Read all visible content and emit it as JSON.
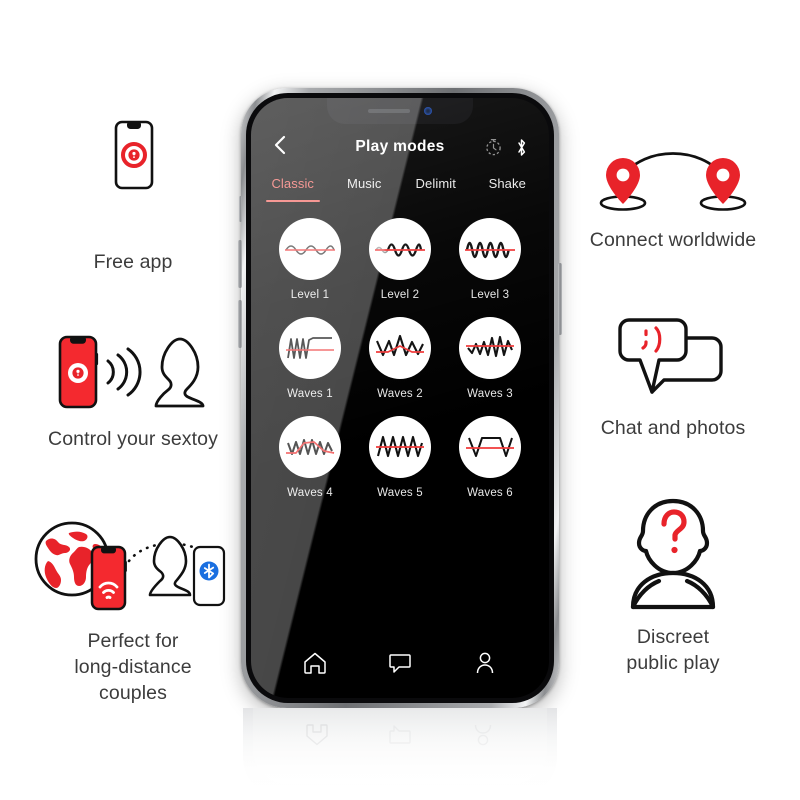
{
  "page": {
    "background_color": "#ffffff",
    "text_color": "#3c3c3c",
    "accent_red": "#e8232a",
    "app_accent": "#f2645f"
  },
  "features_left": [
    {
      "id": "free-app",
      "icon": "phone-with-lock-app-icon",
      "caption": "Free app"
    },
    {
      "id": "control-sextoy",
      "icon": "phone-signal-sextoy-icon",
      "caption": "Control your sextoy"
    },
    {
      "id": "long-distance",
      "icon": "globe-phone-sextoy-bluetooth-icon",
      "caption": "Perfect for\nlong-distance\ncouples"
    }
  ],
  "features_right": [
    {
      "id": "connect-worldwide",
      "icon": "two-map-pins-arc-icon",
      "caption": "Connect worldwide"
    },
    {
      "id": "chat-photos",
      "icon": "two-speech-bubbles-wink-icon",
      "caption": "Chat and photos"
    },
    {
      "id": "discreet",
      "icon": "anonymous-person-question-mark-icon",
      "caption": "Discreet\npublic play"
    }
  ],
  "phone": {
    "status_bar": {
      "speaker": "earpiece-speaker",
      "camera": "front-camera"
    },
    "app": {
      "back_icon": "chevron-left-icon",
      "title": "Play modes",
      "header_icons": [
        {
          "name": "timer-icon",
          "label": "Timer"
        },
        {
          "name": "bluetooth-icon",
          "label": "Bluetooth"
        }
      ],
      "tabs": [
        {
          "label": "Classic",
          "active": true
        },
        {
          "label": "Music",
          "active": false
        },
        {
          "label": "Delimit",
          "active": false
        },
        {
          "label": "Shake",
          "active": false
        }
      ],
      "modes": [
        {
          "label": "Level 1",
          "wave": "low-amplitude-sine"
        },
        {
          "label": "Level 2",
          "wave": "ramping-sine"
        },
        {
          "label": "Level 3",
          "wave": "high-frequency-sine"
        },
        {
          "label": "Waves 1",
          "wave": "burst-then-plateau"
        },
        {
          "label": "Waves 2",
          "wave": "triangle-peak"
        },
        {
          "label": "Waves 3",
          "wave": "rising-zigzag"
        },
        {
          "label": "Waves 4",
          "wave": "dense-zigzag-arc"
        },
        {
          "label": "Waves 5",
          "wave": "sawtooth-run"
        },
        {
          "label": "Waves 6",
          "wave": "step-plateau"
        }
      ],
      "nav": [
        {
          "name": "home-icon",
          "label": "Home"
        },
        {
          "name": "chat-icon",
          "label": "Chat"
        },
        {
          "name": "profile-icon",
          "label": "Profile"
        }
      ]
    }
  }
}
